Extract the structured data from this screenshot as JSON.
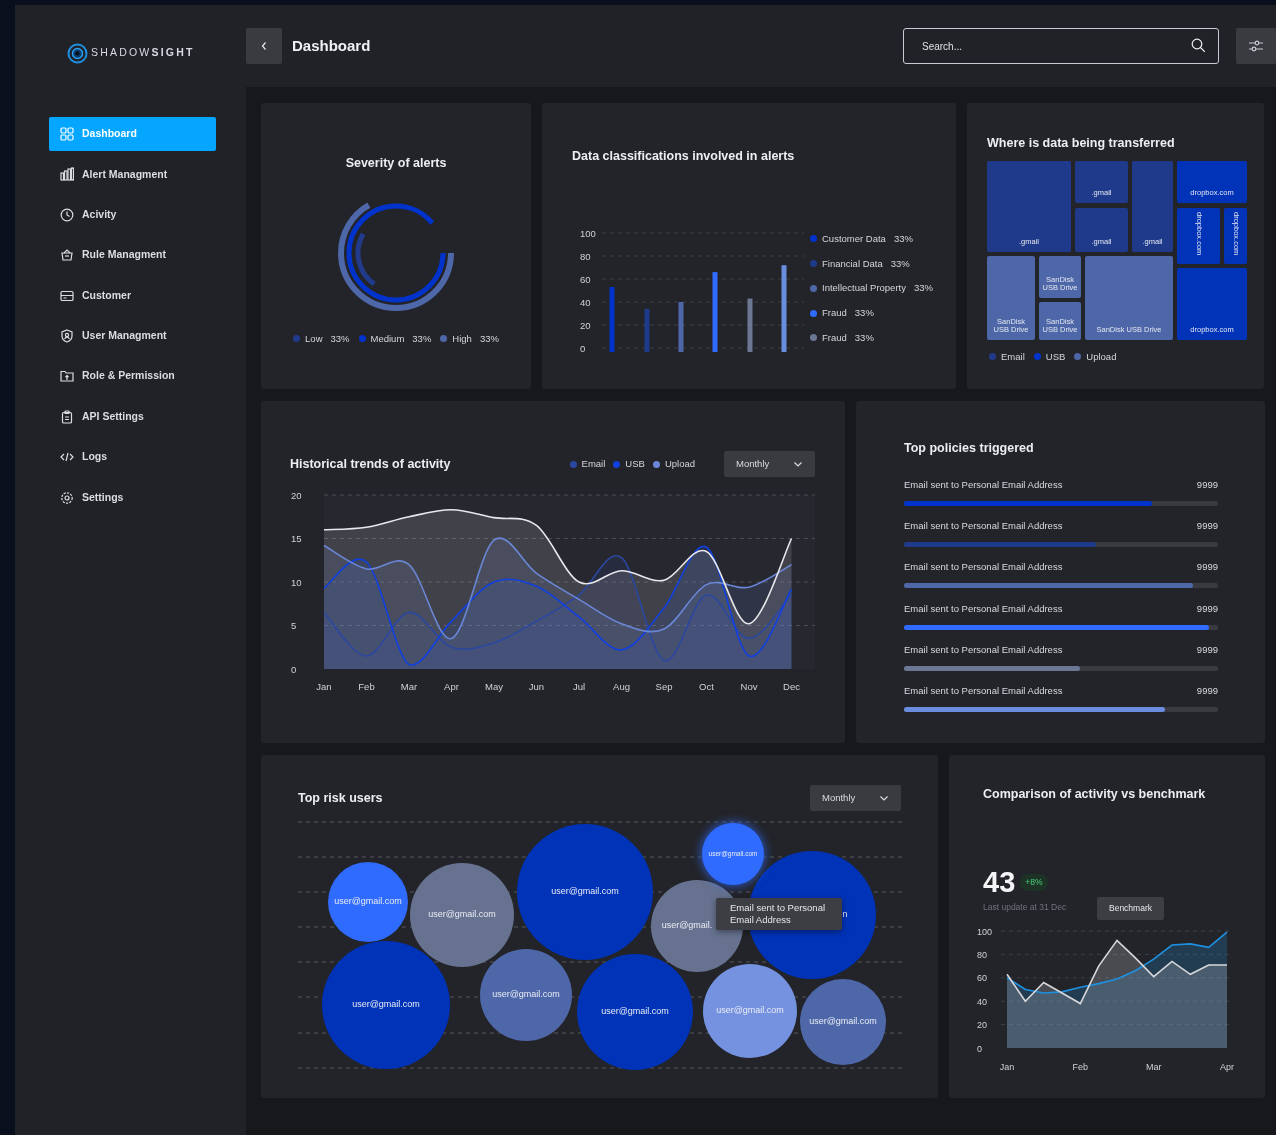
{
  "logo": {
    "text": "SHADOW**SIGHT**"
  },
  "header": {
    "title": "Dashboard",
    "search": {
      "placeholder": "Search..."
    }
  },
  "sidebar": {
    "items": [
      {
        "label": "Dashboard",
        "selected": true
      },
      {
        "label": "Alert Managment",
        "selected": false
      },
      {
        "label": "Acivity",
        "selected": false
      },
      {
        "label": "Rule Managment",
        "selected": false
      },
      {
        "label": "Customer",
        "selected": false
      },
      {
        "label": "User Managment",
        "selected": false
      },
      {
        "label": "Role & Permission",
        "selected": false
      },
      {
        "label": "API Settings",
        "selected": false
      },
      {
        "label": "Logs",
        "selected": false
      },
      {
        "label": "Settings",
        "selected": false
      }
    ]
  },
  "severity": {
    "title": "Severity of alerts",
    "legend": [
      {
        "label": "Low",
        "value": "33%",
        "color": "#213a8c"
      },
      {
        "label": "Medium",
        "value": "33%",
        "color": "#0033cc"
      },
      {
        "label": "High",
        "value": "33%",
        "color": "#4e67a8"
      }
    ]
  },
  "classifications": {
    "title": "Data classifications involved in alerts",
    "chart_data": {
      "type": "bar",
      "grid": true,
      "ylim": [
        0,
        100
      ],
      "yticks": [
        0,
        20,
        40,
        60,
        80,
        100
      ],
      "series": [
        {
          "values": [
            53,
            34,
            40,
            66,
            43,
            72
          ]
        }
      ],
      "colors": [
        "#0033cc",
        "#1e3a8a",
        "#4e67a8",
        "#2f6bff",
        "#6b7793",
        "#6b8de0"
      ]
    },
    "legend": [
      {
        "label": "Customer Data",
        "value": "33%",
        "color": "#0033cc"
      },
      {
        "label": "Financial Data",
        "value": "33%",
        "color": "#1e3a8a"
      },
      {
        "label": "Intellectual Property",
        "value": "33%",
        "color": "#4e67a8"
      },
      {
        "label": "Fraud",
        "value": "33%",
        "color": "#2f6bff"
      },
      {
        "label": "Fraud",
        "value": "33%",
        "color": "#6b7793"
      }
    ]
  },
  "transfers": {
    "title": "Where is data being transferred",
    "tiles": [
      {
        "label": ".gmail",
        "kind": "horizontal",
        "color": "#1f3a8a"
      },
      {
        "label": ".gmail",
        "kind": "horizontal",
        "color": "#1f3a8a"
      },
      {
        "label": ".gmail",
        "kind": "horizontal",
        "color": "#1f3a8a"
      },
      {
        "label": ".gmail",
        "kind": "horizontal",
        "color": "#1f3a8a"
      },
      {
        "label": "dropbox.com",
        "kind": "horizontal",
        "color": "#0033b8"
      },
      {
        "label": "dropbox.com",
        "kind": "vertical",
        "color": "#0033b8"
      },
      {
        "label": "dropbox.com",
        "kind": "vertical",
        "color": "#0033b8"
      },
      {
        "label": "SanDisk USB Drive",
        "kind": "horizontal",
        "color": "#4e67a8"
      },
      {
        "label": "SanDisk USB Drive",
        "kind": "horizontal",
        "color": "#4e67a8"
      },
      {
        "label": "SanDisk USB Drive",
        "kind": "horizontal",
        "color": "#4e67a8"
      },
      {
        "label": "SanDisk USB Drive",
        "kind": "horizontal",
        "color": "#4e67a8"
      },
      {
        "label": "dropbox.com",
        "kind": "horizontal",
        "color": "#0033b8"
      }
    ],
    "legend": [
      {
        "label": "Email",
        "color": "#213a8c"
      },
      {
        "label": "USB",
        "color": "#0033cc"
      },
      {
        "label": "Upload",
        "color": "#4e67a8"
      }
    ]
  },
  "trends": {
    "title": "Historical trends of activity",
    "period": "Monthly",
    "chart_data": {
      "type": "area",
      "grid": true,
      "categories": [
        "Jan",
        "Feb",
        "Mar",
        "Apr",
        "May",
        "Jun",
        "Jul",
        "Aug",
        "Sep",
        "Oct",
        "Nov",
        "Dec"
      ],
      "ylim": [
        0,
        20
      ],
      "yticks": [
        0,
        5,
        10,
        15,
        20
      ],
      "series": [
        {
          "name": "Email",
          "color": "#2a48a0",
          "values": [
            6.5,
            1.5,
            6.5,
            2.5,
            3,
            5.5,
            8.5,
            12.8,
            1,
            8.5,
            3.5,
            8.6
          ]
        },
        {
          "name": "USB",
          "color": "#1040e0",
          "values": [
            9.3,
            12.3,
            0.5,
            5.5,
            10,
            9.5,
            6,
            2.2,
            7,
            14,
            1.5,
            9.2
          ]
        },
        {
          "name": "Upload",
          "color": "#6a86d6",
          "values": [
            14.2,
            11.5,
            12,
            3.5,
            14.8,
            11,
            8,
            5.2,
            4.6,
            9.7,
            9.4,
            12
          ]
        },
        {
          "color": "#e8e8ec",
          "values": [
            16,
            16.3,
            17.5,
            18.3,
            17.4,
            16.5,
            10,
            11.3,
            10.2,
            13.5,
            5.2,
            15
          ]
        }
      ]
    }
  },
  "policies": {
    "title": "Top policies triggered",
    "items": [
      {
        "label": "Email sent to Personal Email Address",
        "value": "9999",
        "level": 0.79,
        "color": "#0033cc"
      },
      {
        "label": "Email sent to Personal Email Address",
        "value": "9999",
        "level": 0.61,
        "color": "#1e3a8a"
      },
      {
        "label": "Email sent to Personal Email Address",
        "value": "9999",
        "level": 0.92,
        "color": "#4e67a8"
      },
      {
        "label": "Email sent to Personal Email Address",
        "value": "9999",
        "level": 0.97,
        "color": "#2f6bff"
      },
      {
        "label": "Email sent to Personal Email Address",
        "value": "9999",
        "level": 0.56,
        "color": "#6b7793"
      },
      {
        "label": "Email sent to Personal Email Address",
        "value": "9999",
        "level": 0.83,
        "color": "#6b8de0"
      }
    ]
  },
  "risk_users": {
    "title": "Top risk users",
    "period": "Monthly",
    "bubbles": [
      {
        "label": "user@gmail.com",
        "color": "#2f6bff"
      },
      {
        "label": "user@gmail.com",
        "color": "#66728f"
      },
      {
        "label": "user@gmail.com",
        "color": "#0033b8"
      },
      {
        "label": "user@gmail.",
        "color": "#66728f"
      },
      {
        "label": "n",
        "color": "#0033b8"
      },
      {
        "label": "user@gmail.com",
        "color": "#2f6bff"
      },
      {
        "label": "user@gmail.com",
        "color": "#0033b8"
      },
      {
        "label": "user@gmail.com",
        "color": "#4e67a8"
      },
      {
        "label": "user@gmail.com",
        "color": "#0033b8"
      },
      {
        "label": "user@gmail.com",
        "color": "#7592e0"
      },
      {
        "label": "user@gmail.com",
        "color": "#4e67a8"
      }
    ],
    "tooltip": "Email sent to Personal Email Address"
  },
  "benchmark": {
    "title": "Comparison of activity vs benchmark",
    "value": "43",
    "change": "+8%",
    "updated": "Last update at 31 Dec",
    "tooltip": "Benchmark",
    "chart_data": {
      "type": "area",
      "grid": true,
      "categories": [
        "Jan",
        null,
        null,
        null,
        "Feb",
        null,
        null,
        null,
        "Mar",
        null,
        null,
        null,
        "Apr"
      ],
      "ylim": [
        0,
        100
      ],
      "yticks": [
        0,
        20,
        40,
        60,
        80,
        100
      ],
      "series": [
        {
          "color": "#1e90e0",
          "values": [
            60,
            50,
            47,
            48,
            52,
            55,
            59,
            66,
            76,
            88,
            89,
            86,
            99
          ]
        },
        {
          "color": "#d8d8dc",
          "values": [
            63,
            40,
            56,
            47,
            38,
            70,
            92,
            77,
            61,
            74,
            63,
            71,
            71
          ]
        }
      ]
    }
  }
}
